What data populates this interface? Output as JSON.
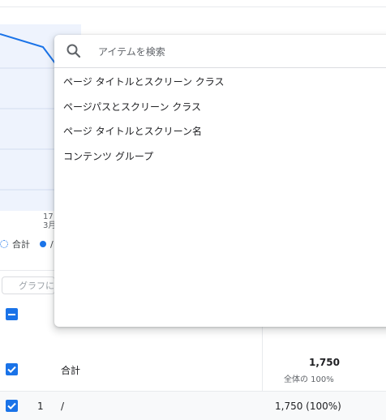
{
  "chart": {
    "x_tick": [
      "17",
      "3月"
    ]
  },
  "legend": {
    "total": "合計",
    "series": "/"
  },
  "filter_chip": {
    "label": "グラフに"
  },
  "dropdown": {
    "search_placeholder": "アイテムを検索",
    "options": [
      "ページ タイトルとスクリーン クラス",
      "ページパスとスクリーン クラス",
      "ページ タイトルとスクリーン名",
      "コンテンツ グループ"
    ]
  },
  "table": {
    "total_row": {
      "label": "合計",
      "value": "1,750",
      "sub": "全体の 100%"
    },
    "rows": [
      {
        "index": "1",
        "path": "/",
        "value": "1,750 (100%)"
      }
    ]
  },
  "colors": {
    "accent": "#1a73e8"
  }
}
